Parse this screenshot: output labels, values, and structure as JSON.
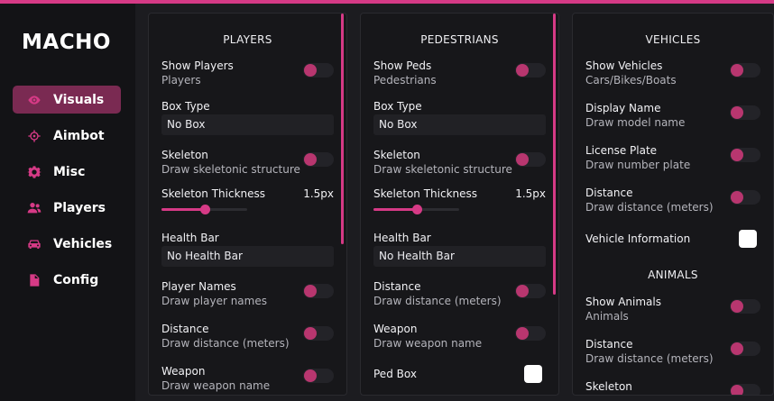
{
  "app": {
    "logo": "MACHO"
  },
  "colors": {
    "accent": "#d63a86",
    "active_nav": "#7a2a52"
  },
  "nav": [
    {
      "label": "Visuals",
      "icon": "eye-icon",
      "active": true
    },
    {
      "label": "Aimbot",
      "icon": "crosshair-icon",
      "active": false
    },
    {
      "label": "Misc",
      "icon": "gear-icon",
      "active": false
    },
    {
      "label": "Players",
      "icon": "users-icon",
      "active": false
    },
    {
      "label": "Vehicles",
      "icon": "car-icon",
      "active": false
    },
    {
      "label": "Config",
      "icon": "file-icon",
      "active": false
    }
  ],
  "players_panel": {
    "title": "PLAYERS",
    "show_players": {
      "label": "Show Players",
      "sub": "Players",
      "enabled": false
    },
    "box_type": {
      "label": "Box Type",
      "value": "No Box"
    },
    "skeleton": {
      "label": "Skeleton",
      "sub": "Draw skeletonic structure",
      "enabled": false
    },
    "skeleton_thickness": {
      "label": "Skeleton Thickness",
      "value": "1.5px",
      "fraction": 0.5
    },
    "health_bar": {
      "label": "Health Bar",
      "value": "No Health Bar"
    },
    "player_names": {
      "label": "Player Names",
      "sub": "Draw player names",
      "enabled": false
    },
    "distance": {
      "label": "Distance",
      "sub": "Draw distance (meters)",
      "enabled": false
    },
    "weapon": {
      "label": "Weapon",
      "sub": "Draw weapon name",
      "enabled": false
    }
  },
  "pedestrians_panel": {
    "title": "PEDESTRIANS",
    "show_peds": {
      "label": "Show Peds",
      "sub": "Pedestrians",
      "enabled": false
    },
    "box_type": {
      "label": "Box Type",
      "value": "No Box"
    },
    "skeleton": {
      "label": "Skeleton",
      "sub": "Draw skeletonic structure",
      "enabled": false
    },
    "skeleton_thickness": {
      "label": "Skeleton Thickness",
      "value": "1.5px",
      "fraction": 0.5
    },
    "health_bar": {
      "label": "Health Bar",
      "value": "No Health Bar"
    },
    "distance": {
      "label": "Distance",
      "sub": "Draw distance (meters)",
      "enabled": false
    },
    "weapon": {
      "label": "Weapon",
      "sub": "Draw weapon name",
      "enabled": false
    },
    "ped_box": {
      "label": "Ped Box",
      "checked": false
    }
  },
  "vehicles_panel": {
    "title": "VEHICLES",
    "show_vehicles": {
      "label": "Show Vehicles",
      "sub": "Cars/Bikes/Boats",
      "enabled": false
    },
    "display_name": {
      "label": "Display Name",
      "sub": "Draw model name",
      "enabled": false
    },
    "license_plate": {
      "label": "License Plate",
      "sub": "Draw number plate",
      "enabled": false
    },
    "distance": {
      "label": "Distance",
      "sub": "Draw distance (meters)",
      "enabled": false
    },
    "vehicle_information": {
      "label": "Vehicle Information",
      "checked": false
    },
    "animals_title": "ANIMALS",
    "show_animals": {
      "label": "Show Animals",
      "sub": "Animals",
      "enabled": false
    },
    "animal_distance": {
      "label": "Distance",
      "sub": "Draw distance (meters)",
      "enabled": false
    },
    "animal_skeleton": {
      "label": "Skeleton",
      "enabled": false
    }
  }
}
